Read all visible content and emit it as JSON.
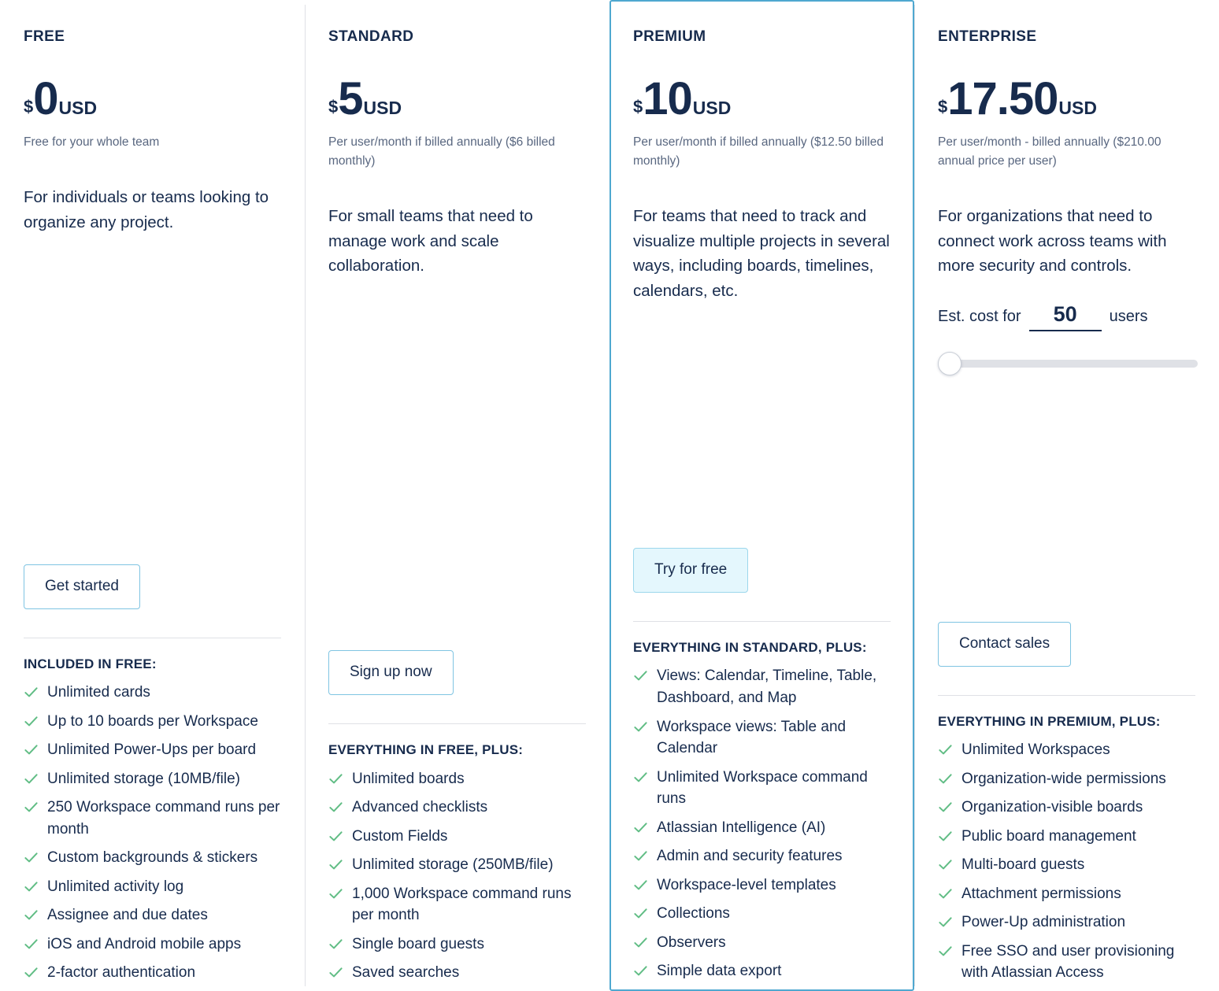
{
  "theme": {
    "text_dark": "#172b4d",
    "text_muted": "#596780",
    "accent_border": "#4fa8d0",
    "button_border": "#7fc4e2",
    "button_fill": "#e4f7fd",
    "check_green": "#61bd85",
    "divider": "#dfe1e6",
    "slider_track": "#dfe1e6"
  },
  "plans": [
    {
      "name": "FREE",
      "currency": "$",
      "amount": "0",
      "unit": "USD",
      "price_note": "Free for your whole team",
      "description": "For individuals or teams looking to organize any project.",
      "cta_label": "Get started",
      "cta_style": "outline",
      "highlighted": false,
      "features_title": "INCLUDED IN FREE:",
      "features": [
        "Unlimited cards",
        "Up to 10 boards per Workspace",
        "Unlimited Power-Ups per board",
        "Unlimited storage (10MB/file)",
        "250 Workspace command runs per month",
        "Custom backgrounds & stickers",
        "Unlimited activity log",
        "Assignee and due dates",
        "iOS and Android mobile apps",
        "2-factor authentication"
      ]
    },
    {
      "name": "STANDARD",
      "currency": "$",
      "amount": "5",
      "unit": "USD",
      "price_note": "Per user/month if billed annually ($6 billed monthly)",
      "description": "For small teams that need to manage work and scale collaboration.",
      "cta_label": "Sign up now",
      "cta_style": "outline",
      "highlighted": false,
      "features_title": "EVERYTHING IN FREE, PLUS:",
      "features": [
        "Unlimited boards",
        "Advanced checklists",
        "Custom Fields",
        "Unlimited storage (250MB/file)",
        "1,000 Workspace command runs per month",
        "Single board guests",
        "Saved searches"
      ]
    },
    {
      "name": "PREMIUM",
      "currency": "$",
      "amount": "10",
      "unit": "USD",
      "price_note": "Per user/month if billed annually ($12.50 billed monthly)",
      "description": "For teams that need to track and visualize multiple projects in several ways, including boards, timelines, calendars, etc.",
      "cta_label": "Try for free",
      "cta_style": "filled",
      "highlighted": true,
      "features_title": "EVERYTHING IN STANDARD, PLUS:",
      "features": [
        "Views: Calendar, Timeline, Table, Dashboard, and Map",
        "Workspace views: Table and Calendar",
        "Unlimited Workspace command runs",
        "Atlassian Intelligence (AI)",
        "Admin and security features",
        "Workspace-level templates",
        "Collections",
        "Observers",
        "Simple data export"
      ]
    },
    {
      "name": "ENTERPRISE",
      "currency": "$",
      "amount": "17.50",
      "unit": "USD",
      "price_note": "Per user/month - billed annually ($210.00 annual price per user)",
      "description": "For organizations that need to connect work across teams with more security and controls.",
      "cta_label": "Contact sales",
      "cta_style": "outline",
      "highlighted": false,
      "estimator": {
        "label_before": "Est. cost for",
        "value": "50",
        "label_after": "users",
        "slider_position_percent": 0
      },
      "features_title": "EVERYTHING IN PREMIUM, PLUS:",
      "features": [
        "Unlimited Workspaces",
        "Organization-wide permissions",
        "Organization-visible boards",
        "Public board management",
        "Multi-board guests",
        "Attachment permissions",
        "Power-Up administration",
        "Free SSO and user provisioning with Atlassian Access"
      ]
    }
  ]
}
